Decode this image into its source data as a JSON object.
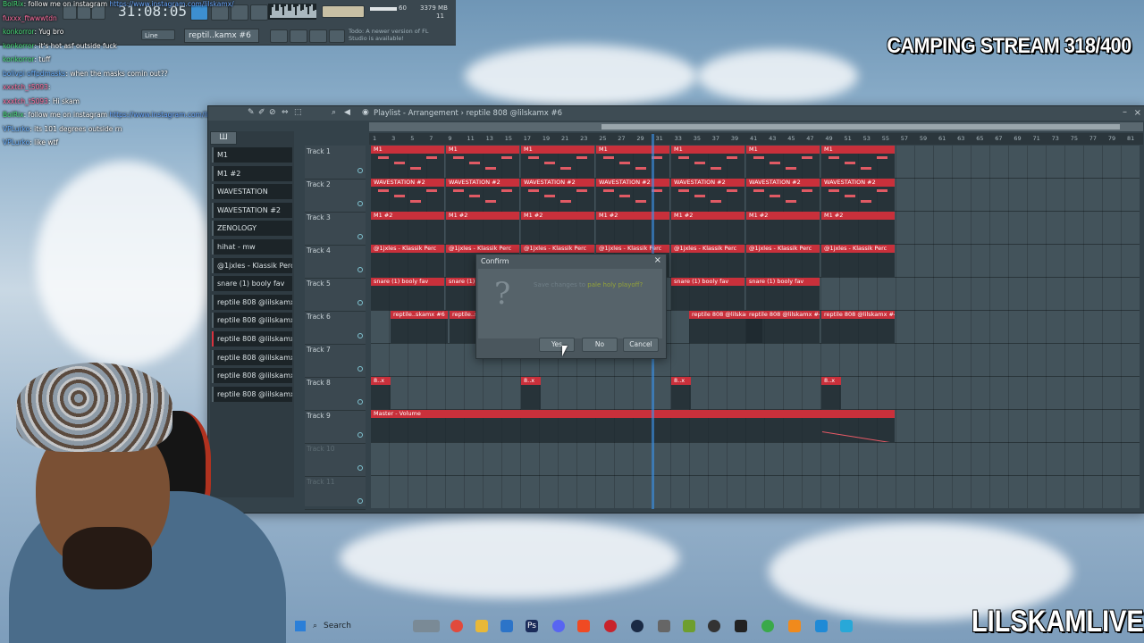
{
  "stream": {
    "title": "CAMPING STREAM 318/400",
    "brand": "LILSKAMLIVE"
  },
  "toolbar": {
    "time": "31:08:05",
    "cpu_mem": "60",
    "mem": "3379 MB",
    "cpu2": "11",
    "line_mode": "Line",
    "pattern": "reptil..kamx #6",
    "hint": "Todo: A newer version of FL Studio is available!"
  },
  "chat": [
    {
      "user": "BolRix",
      "text": ": follow me on instagram ",
      "link": "https://www.instagram.com/lilskamx/",
      "color": "green"
    },
    {
      "user": "fuxxx_ftwwwtdn",
      "text": "",
      "link": "",
      "color": "pink"
    },
    {
      "user": "konkorror",
      "text": ": Yug bro",
      "link": "",
      "color": "green"
    },
    {
      "user": "konkorror",
      "text": ": it's hot asf outside fuck",
      "link": "",
      "color": "green"
    },
    {
      "user": "konkorror",
      "text": ": tuff",
      "link": "",
      "color": "green"
    },
    {
      "user": "bolivpi offpdmasks",
      "text": ": when the masks comin out??",
      "link": "",
      "color": "blue"
    },
    {
      "user": "xxxtch_t5093",
      "text": ":",
      "link": "",
      "color": "pink"
    },
    {
      "user": "xxxtch_t5093",
      "text": ": Hi skam",
      "link": "",
      "color": "pink"
    },
    {
      "user": "BolRix",
      "text": ": follow me on instagram ",
      "link": "https://www.instagram.com/lilskamx/",
      "color": "green"
    },
    {
      "user": "VPLurko",
      "text": ": its 101 degrees outside rn",
      "link": "",
      "color": "blue"
    },
    {
      "user": "VPLurko",
      "text": ": like wtf",
      "link": "",
      "color": "blue"
    }
  ],
  "playlist": {
    "title": "Playlist - Arrangement",
    "pattern_name": "reptile 808 @lilskamx #6",
    "picker": [
      "M1",
      "M1 #2",
      "WAVESTATION",
      "WAVESTATION #2",
      "ZENOLOGY",
      "hihat - mw",
      "@1jxles - Klassik Perc",
      "snare (1) booly fav",
      "reptile 808 @lilskamx",
      "reptile 808 @lilskamx #2",
      "reptile 808 @lilskamx #6",
      "reptile 808 @lilskamx #4",
      "reptile 808 @lilskamx #3",
      "reptile 808 @lilskamx #5"
    ],
    "picker_selected": 10,
    "tracks": [
      "Track 1",
      "Track 2",
      "Track 3",
      "Track 4",
      "Track 5",
      "Track 6",
      "Track 7",
      "Track 8",
      "Track 9",
      "Track 10",
      "Track 11"
    ],
    "ruler": [
      "1",
      "3",
      "5",
      "7",
      "9",
      "11",
      "13",
      "15",
      "17",
      "19",
      "21",
      "23",
      "25",
      "27",
      "29",
      "31",
      "33",
      "35",
      "37",
      "39",
      "41",
      "43",
      "45",
      "47",
      "49",
      "51",
      "53",
      "55",
      "57",
      "59",
      "61",
      "63",
      "65",
      "67",
      "69",
      "71",
      "73",
      "75",
      "77",
      "79",
      "81"
    ],
    "clip_labels": {
      "t1": "M1",
      "t2": "WAVESTATION #2",
      "t3": "M1 #2",
      "t4": "@1jxles - Klassik Perc",
      "t5": "snare (1) booly fav",
      "t6": "reptile..skamx #6",
      "t6b": "reptile 808 @lilskamx #4",
      "t8": "8..x",
      "t9": "Master - Volume"
    }
  },
  "dialog": {
    "title": "Confirm",
    "icon": "?",
    "message": "Save changes to ",
    "message_file": "pale holy playoff?",
    "yes": "Yes",
    "no": "No",
    "cancel": "Cancel"
  },
  "taskbar": {
    "search": "Search"
  },
  "colors": {
    "clip_red": "#c9303b",
    "accent_blue": "#3c96f0"
  }
}
